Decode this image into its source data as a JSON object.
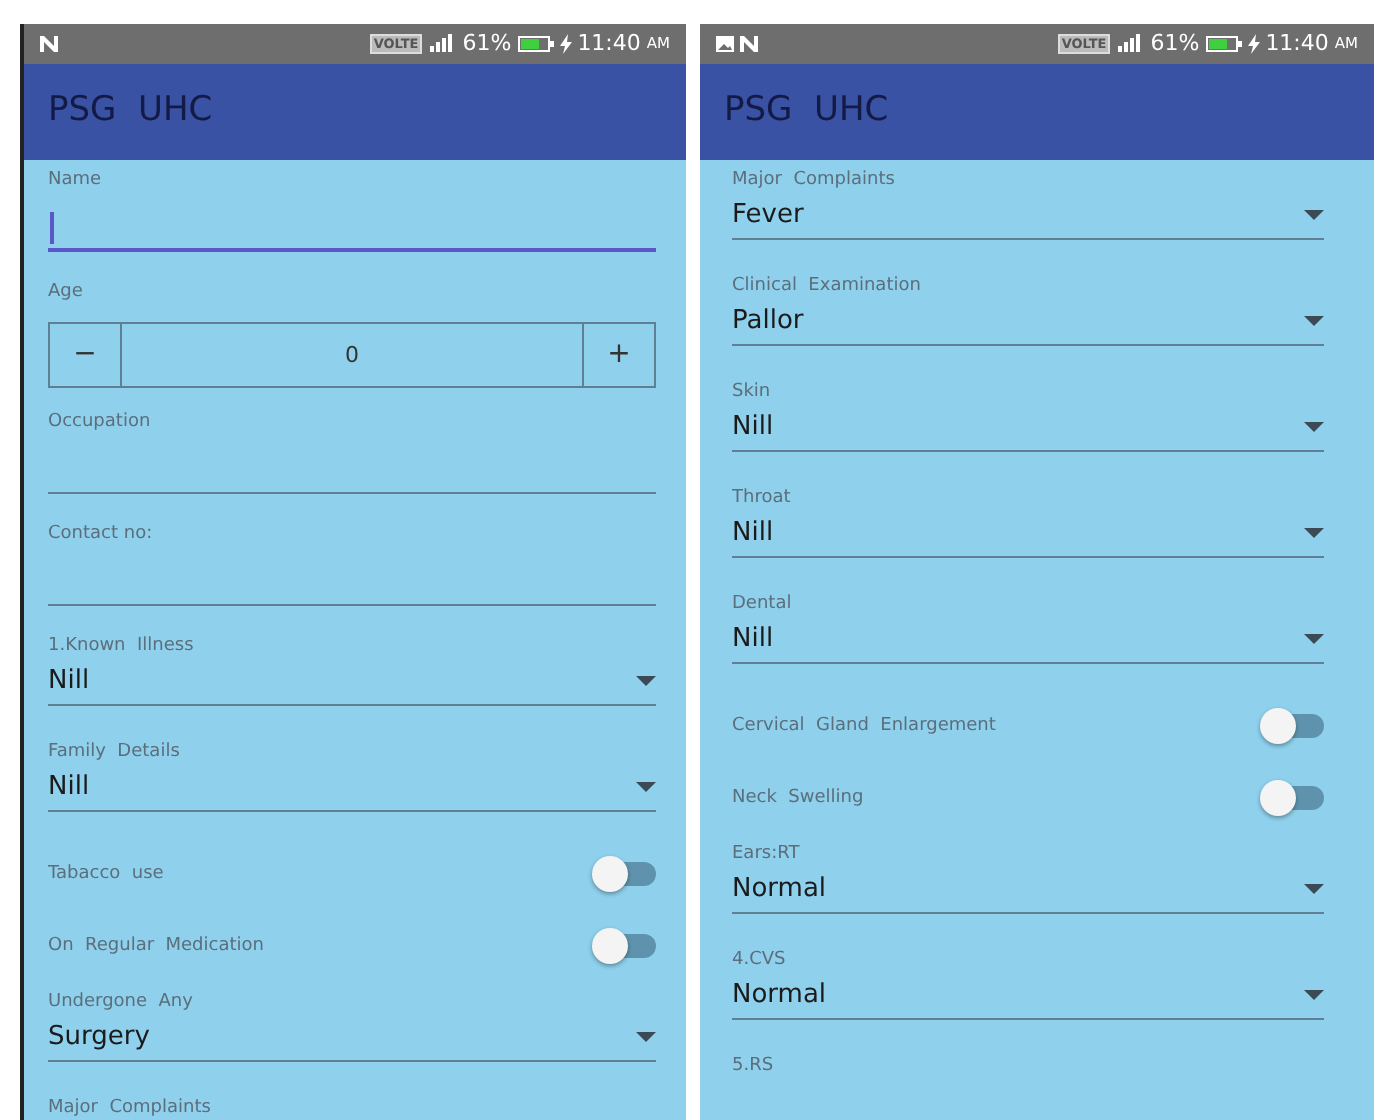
{
  "screens": [
    {
      "status_bar": {
        "network": "VOLTE",
        "battery": "61%",
        "time": "11:40",
        "meridiem": "AM"
      },
      "app_bar": {
        "title": "PSG  UHC"
      },
      "fields": [
        {
          "kind": "text",
          "label": "Name",
          "focused": true
        },
        {
          "kind": "stepper",
          "label": "Age",
          "minus": "−",
          "value": "0",
          "plus": "+"
        },
        {
          "kind": "text",
          "label": "Occupation",
          "focused": false
        },
        {
          "kind": "text",
          "label": "Contact no:",
          "focused": false
        },
        {
          "kind": "select",
          "label": "1.Known  Illness",
          "value": "Nill"
        },
        {
          "kind": "select",
          "label": "Family  Details",
          "value": "Nill"
        },
        {
          "kind": "switch",
          "label": "Tabacco  use",
          "on": false
        },
        {
          "kind": "switch",
          "label": "On  Regular  Medication",
          "on": false
        },
        {
          "kind": "select",
          "label": "Undergone  Any",
          "value": "Surgery"
        },
        {
          "kind": "label",
          "label": "Major  Complaints"
        }
      ]
    },
    {
      "status_bar": {
        "image_notification": true,
        "network": "VOLTE",
        "battery": "61%",
        "time": "11:40",
        "meridiem": "AM"
      },
      "app_bar": {
        "title": "PSG  UHC"
      },
      "fields": [
        {
          "kind": "select",
          "label": "Major  Complaints",
          "value": "Fever"
        },
        {
          "kind": "select",
          "label": "Clinical  Examination",
          "value": "Pallor"
        },
        {
          "kind": "select",
          "label": "Skin",
          "value": "Nill"
        },
        {
          "kind": "select",
          "label": "Throat",
          "value": "Nill"
        },
        {
          "kind": "select",
          "label": "Dental",
          "value": "Nill"
        },
        {
          "kind": "switch",
          "label": "Cervical  Gland  Enlargement",
          "on": false
        },
        {
          "kind": "switch",
          "label": "Neck  Swelling",
          "on": false
        },
        {
          "kind": "select",
          "label": "Ears:RT",
          "value": "Normal"
        },
        {
          "kind": "select",
          "label": "4.CVS",
          "value": "Normal"
        },
        {
          "kind": "label",
          "label": "5.RS"
        }
      ]
    }
  ]
}
